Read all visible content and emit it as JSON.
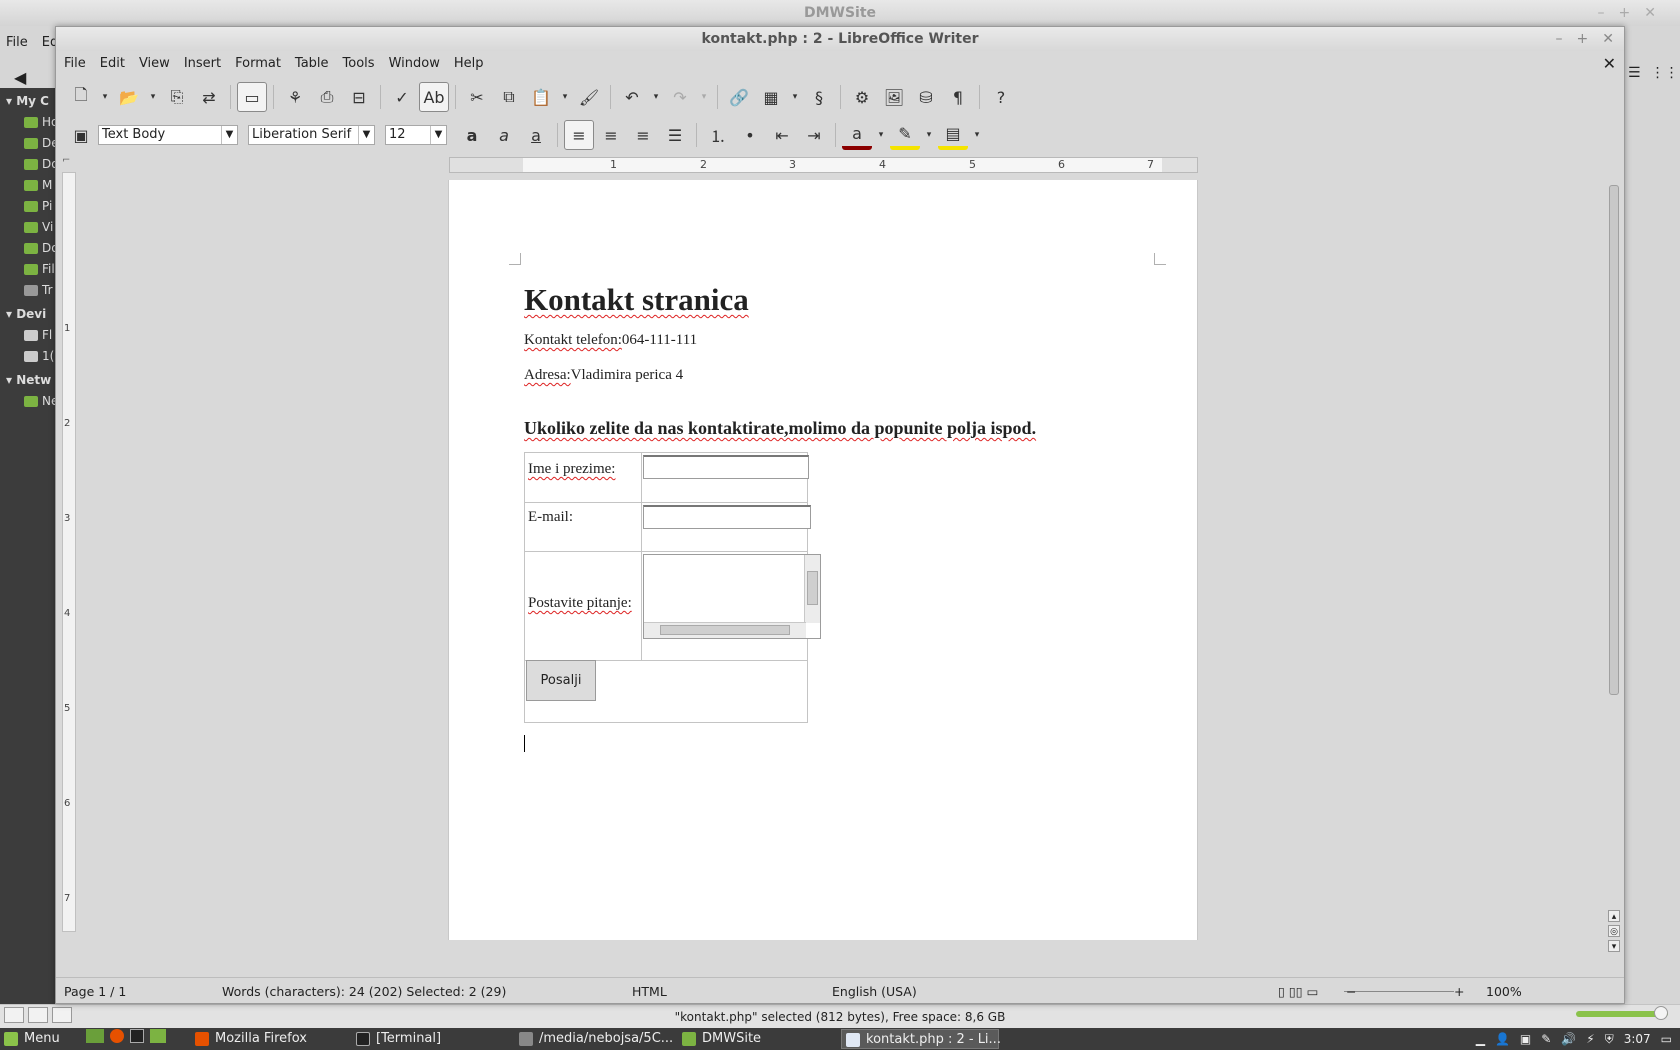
{
  "background_window": {
    "title": "DMWSite",
    "menu": [
      "File",
      "Edi"
    ],
    "sidebar": {
      "sections": [
        {
          "label": "My C",
          "items": [
            "Ho",
            "De",
            "Do",
            "M",
            "Pi",
            "Vi",
            "Do",
            "Fil",
            "Tr"
          ]
        },
        {
          "label": "Devi",
          "items": [
            "Fl",
            "1("
          ]
        },
        {
          "label": "Netw",
          "items": [
            "Ne"
          ]
        }
      ]
    },
    "status": "\"kontakt.php\" selected (812 bytes), Free space: 8,6 GB"
  },
  "writer": {
    "title": "kontakt.php : 2 - LibreOffice Writer",
    "menu": [
      "File",
      "Edit",
      "View",
      "Insert",
      "Format",
      "Table",
      "Tools",
      "Window",
      "Help"
    ],
    "paragraph_style": "Text Body",
    "font_name": "Liberation Serif",
    "font_size": "12",
    "ruler_numbers": [
      "1",
      "2",
      "3",
      "4",
      "5",
      "6",
      "7"
    ],
    "vruler_numbers": [
      "1",
      "2",
      "3",
      "4",
      "5",
      "6",
      "7"
    ],
    "status": {
      "page": "Page 1 / 1",
      "words": "Words (characters): 24 (202) Selected: 2 (29)",
      "format": "HTML",
      "language": "English (USA)",
      "zoom": "100%"
    }
  },
  "document": {
    "heading": "Kontakt stranica",
    "phone_label": "Kontakt telefon:",
    "phone": "064-111-111",
    "address_label": "Adresa:",
    "address": "Vladimira perica 4",
    "prompt": "Ukoliko zelite da nas kontaktirate,molimo da popunite polja ispod.",
    "form": {
      "name_label": "Ime i prezime:",
      "email_label": "E-mail:",
      "question_label": "Postavite pitanje:",
      "submit": "Posalji"
    }
  },
  "taskbar": {
    "menu": "Menu",
    "items": [
      "Mozilla Firefox",
      "[Terminal]",
      "/media/nebojsa/5C...",
      "DMWSite",
      "kontakt.php : 2 - Li..."
    ],
    "clock": "3:07"
  }
}
